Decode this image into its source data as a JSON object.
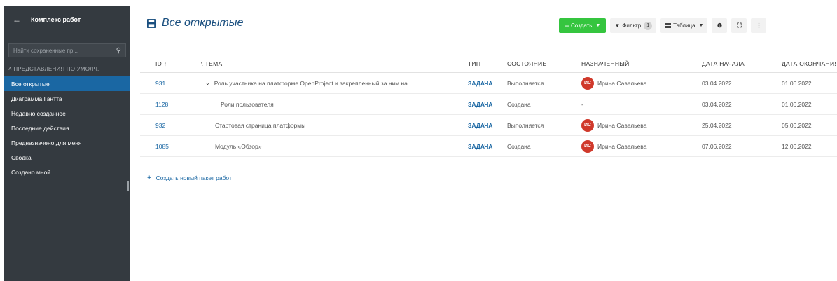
{
  "sidebar": {
    "title": "Комплекс работ",
    "search_placeholder": "Найти сохраненные пр...",
    "section_label": "ПРЕДСТАВЛЕНИЯ ПО УМОЛЧ.",
    "items": [
      {
        "label": "Все открытые",
        "active": true
      },
      {
        "label": "Диаграмма Гантта"
      },
      {
        "label": "Недавно созданное"
      },
      {
        "label": "Последние действия"
      },
      {
        "label": "Предназначено для меня"
      },
      {
        "label": "Сводка"
      },
      {
        "label": "Создано мной"
      }
    ]
  },
  "header": {
    "title": "Все открытые",
    "create_label": "Создать",
    "filter_label": "Фильтр",
    "filter_count": "1",
    "view_label": "Таблица",
    "info_icon": "info-icon",
    "fullscreen_icon": "fullscreen-icon",
    "more_icon": "more-icon"
  },
  "table": {
    "columns": {
      "id": "ID",
      "subject": "ТЕМА",
      "type": "ТИП",
      "status": "СОСТОЯНИЕ",
      "assignee": "НАЗНАЧЕННЫЙ",
      "start": "ДАТА НАЧАЛА",
      "due": "ДАТА ОКОНЧАНИЯ"
    },
    "rows": [
      {
        "id": "931",
        "subject": "Роль участника на платформе OpenProject и закрепленный за ним на...",
        "type": "ЗАДАЧА",
        "status": "Выполняется",
        "assignee_initials": "ИС",
        "assignee": "Ирина Савельева",
        "start": "03.04.2022",
        "due": "01.06.2022"
      },
      {
        "id": "1128",
        "subject": "Роли пользователя",
        "type": "ЗАДАЧА",
        "status": "Создана",
        "assignee": "-",
        "start": "03.04.2022",
        "due": "01.06.2022"
      },
      {
        "id": "932",
        "subject": "Стартовая страница платформы",
        "type": "ЗАДАЧА",
        "status": "Выполняется",
        "assignee_initials": "ИС",
        "assignee": "Ирина Савельева",
        "start": "25.04.2022",
        "due": "05.06.2022"
      },
      {
        "id": "1085",
        "subject": "Модуль «Обзор»",
        "type": "ЗАДАЧА",
        "status": "Создана",
        "assignee_initials": "ИС",
        "assignee": "Ирина Савельева",
        "start": "07.06.2022",
        "due": "12.06.2022"
      }
    ],
    "create_link": "Создать новый пакет работ"
  },
  "colors": {
    "sidebar_bg": "#343a40",
    "active_item": "#1a67a3",
    "create_btn": "#35c53f",
    "avatar": "#d0392b",
    "link": "#1a67a3"
  }
}
